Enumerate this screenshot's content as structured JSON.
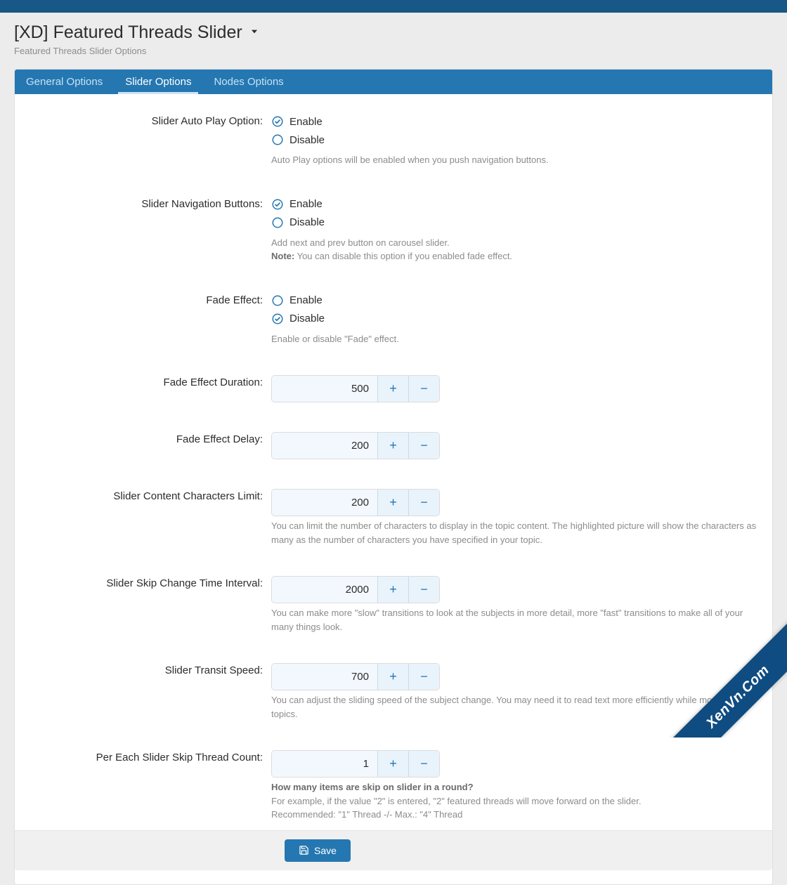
{
  "page": {
    "title": "[XD] Featured Threads Slider",
    "subtitle": "Featured Threads Slider Options"
  },
  "tabs": [
    {
      "label": "General Options",
      "active": false
    },
    {
      "label": "Slider Options",
      "active": true
    },
    {
      "label": "Nodes Options",
      "active": false
    }
  ],
  "labels": {
    "enable": "Enable",
    "disable": "Disable"
  },
  "options": {
    "auto_play": {
      "label": "Slider Auto Play Option:",
      "value": "enable",
      "help": "Auto Play options will be enabled when you push navigation buttons."
    },
    "nav_buttons": {
      "label": "Slider Navigation Buttons:",
      "value": "enable",
      "help_pre": "Add next and prev button on carousel slider.",
      "note_label": "Note:",
      "note_text": " You can disable this option if you enabled fade effect."
    },
    "fade_effect": {
      "label": "Fade Effect:",
      "value": "disable",
      "help": "Enable or disable \"Fade\" effect."
    },
    "fade_duration": {
      "label": "Fade Effect Duration:",
      "value": "500"
    },
    "fade_delay": {
      "label": "Fade Effect Delay:",
      "value": "200"
    },
    "chars_limit": {
      "label": "Slider Content Characters Limit:",
      "value": "200",
      "help": "You can limit the number of characters to display in the topic content. The highlighted picture will show the characters as many as the number of characters you have specified in your topic."
    },
    "change_interval": {
      "label": "Slider Skip Change Time Interval:",
      "value": "2000",
      "help": "You can make more \"slow\" transitions to look at the subjects in more detail, more \"fast\" transitions to make all of your many things look."
    },
    "transit_speed": {
      "label": "Slider Transit Speed:",
      "value": "700",
      "help": "You can adjust the sliding speed of the subject change. You may need it to read text more efficiently while moving topics."
    },
    "skip_count": {
      "label": "Per Each Slider Skip Thread Count:",
      "value": "1",
      "help_bold": "How many items are skip on slider in a round?",
      "help_l1": "For example, if the value \"2\" is entered, \"2\" featured threads will move forward on the slider.",
      "help_l2": "Recommended: \"1\" Thread -/- Max.: \"4\" Thread"
    }
  },
  "buttons": {
    "save": "Save"
  },
  "watermark": "XenVn.Com"
}
